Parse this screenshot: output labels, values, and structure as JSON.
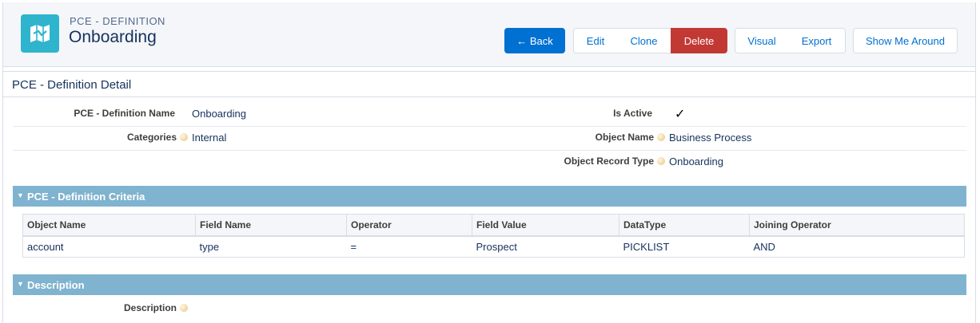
{
  "header": {
    "eyebrow": "PCE - DEFINITION",
    "title": "Onboarding",
    "logo_icon": "map-icon",
    "buttons": {
      "back": "← Back",
      "edit": "Edit",
      "clone": "Clone",
      "delete": "Delete",
      "visual": "Visual",
      "export": "Export",
      "show_me_around": "Show Me Around"
    }
  },
  "detail": {
    "title": "PCE - Definition Detail",
    "fields": {
      "definition_name_label": "PCE - Definition Name",
      "definition_name_value": "Onboarding",
      "categories_label": "Categories",
      "categories_value": "Internal",
      "is_active_label": "Is Active",
      "is_active_value": "✓",
      "object_name_label": "Object Name",
      "object_name_value": "Business Process",
      "object_record_type_label": "Object Record Type",
      "object_record_type_value": "Onboarding"
    }
  },
  "criteria": {
    "section_title": "PCE - Definition Criteria",
    "columns": [
      "Object Name",
      "Field Name",
      "Operator",
      "Field Value",
      "DataType",
      "Joining Operator"
    ],
    "rows": [
      [
        "account",
        "type",
        "=",
        "Prospect",
        "PICKLIST",
        "AND"
      ]
    ]
  },
  "description": {
    "section_title": "Description",
    "label": "Description",
    "value": ""
  },
  "colors": {
    "brand_blue": "#0070d2",
    "delete_red": "#c23934",
    "section_bg": "#7fb3cf",
    "logo_bg": "#2fb4cd"
  }
}
